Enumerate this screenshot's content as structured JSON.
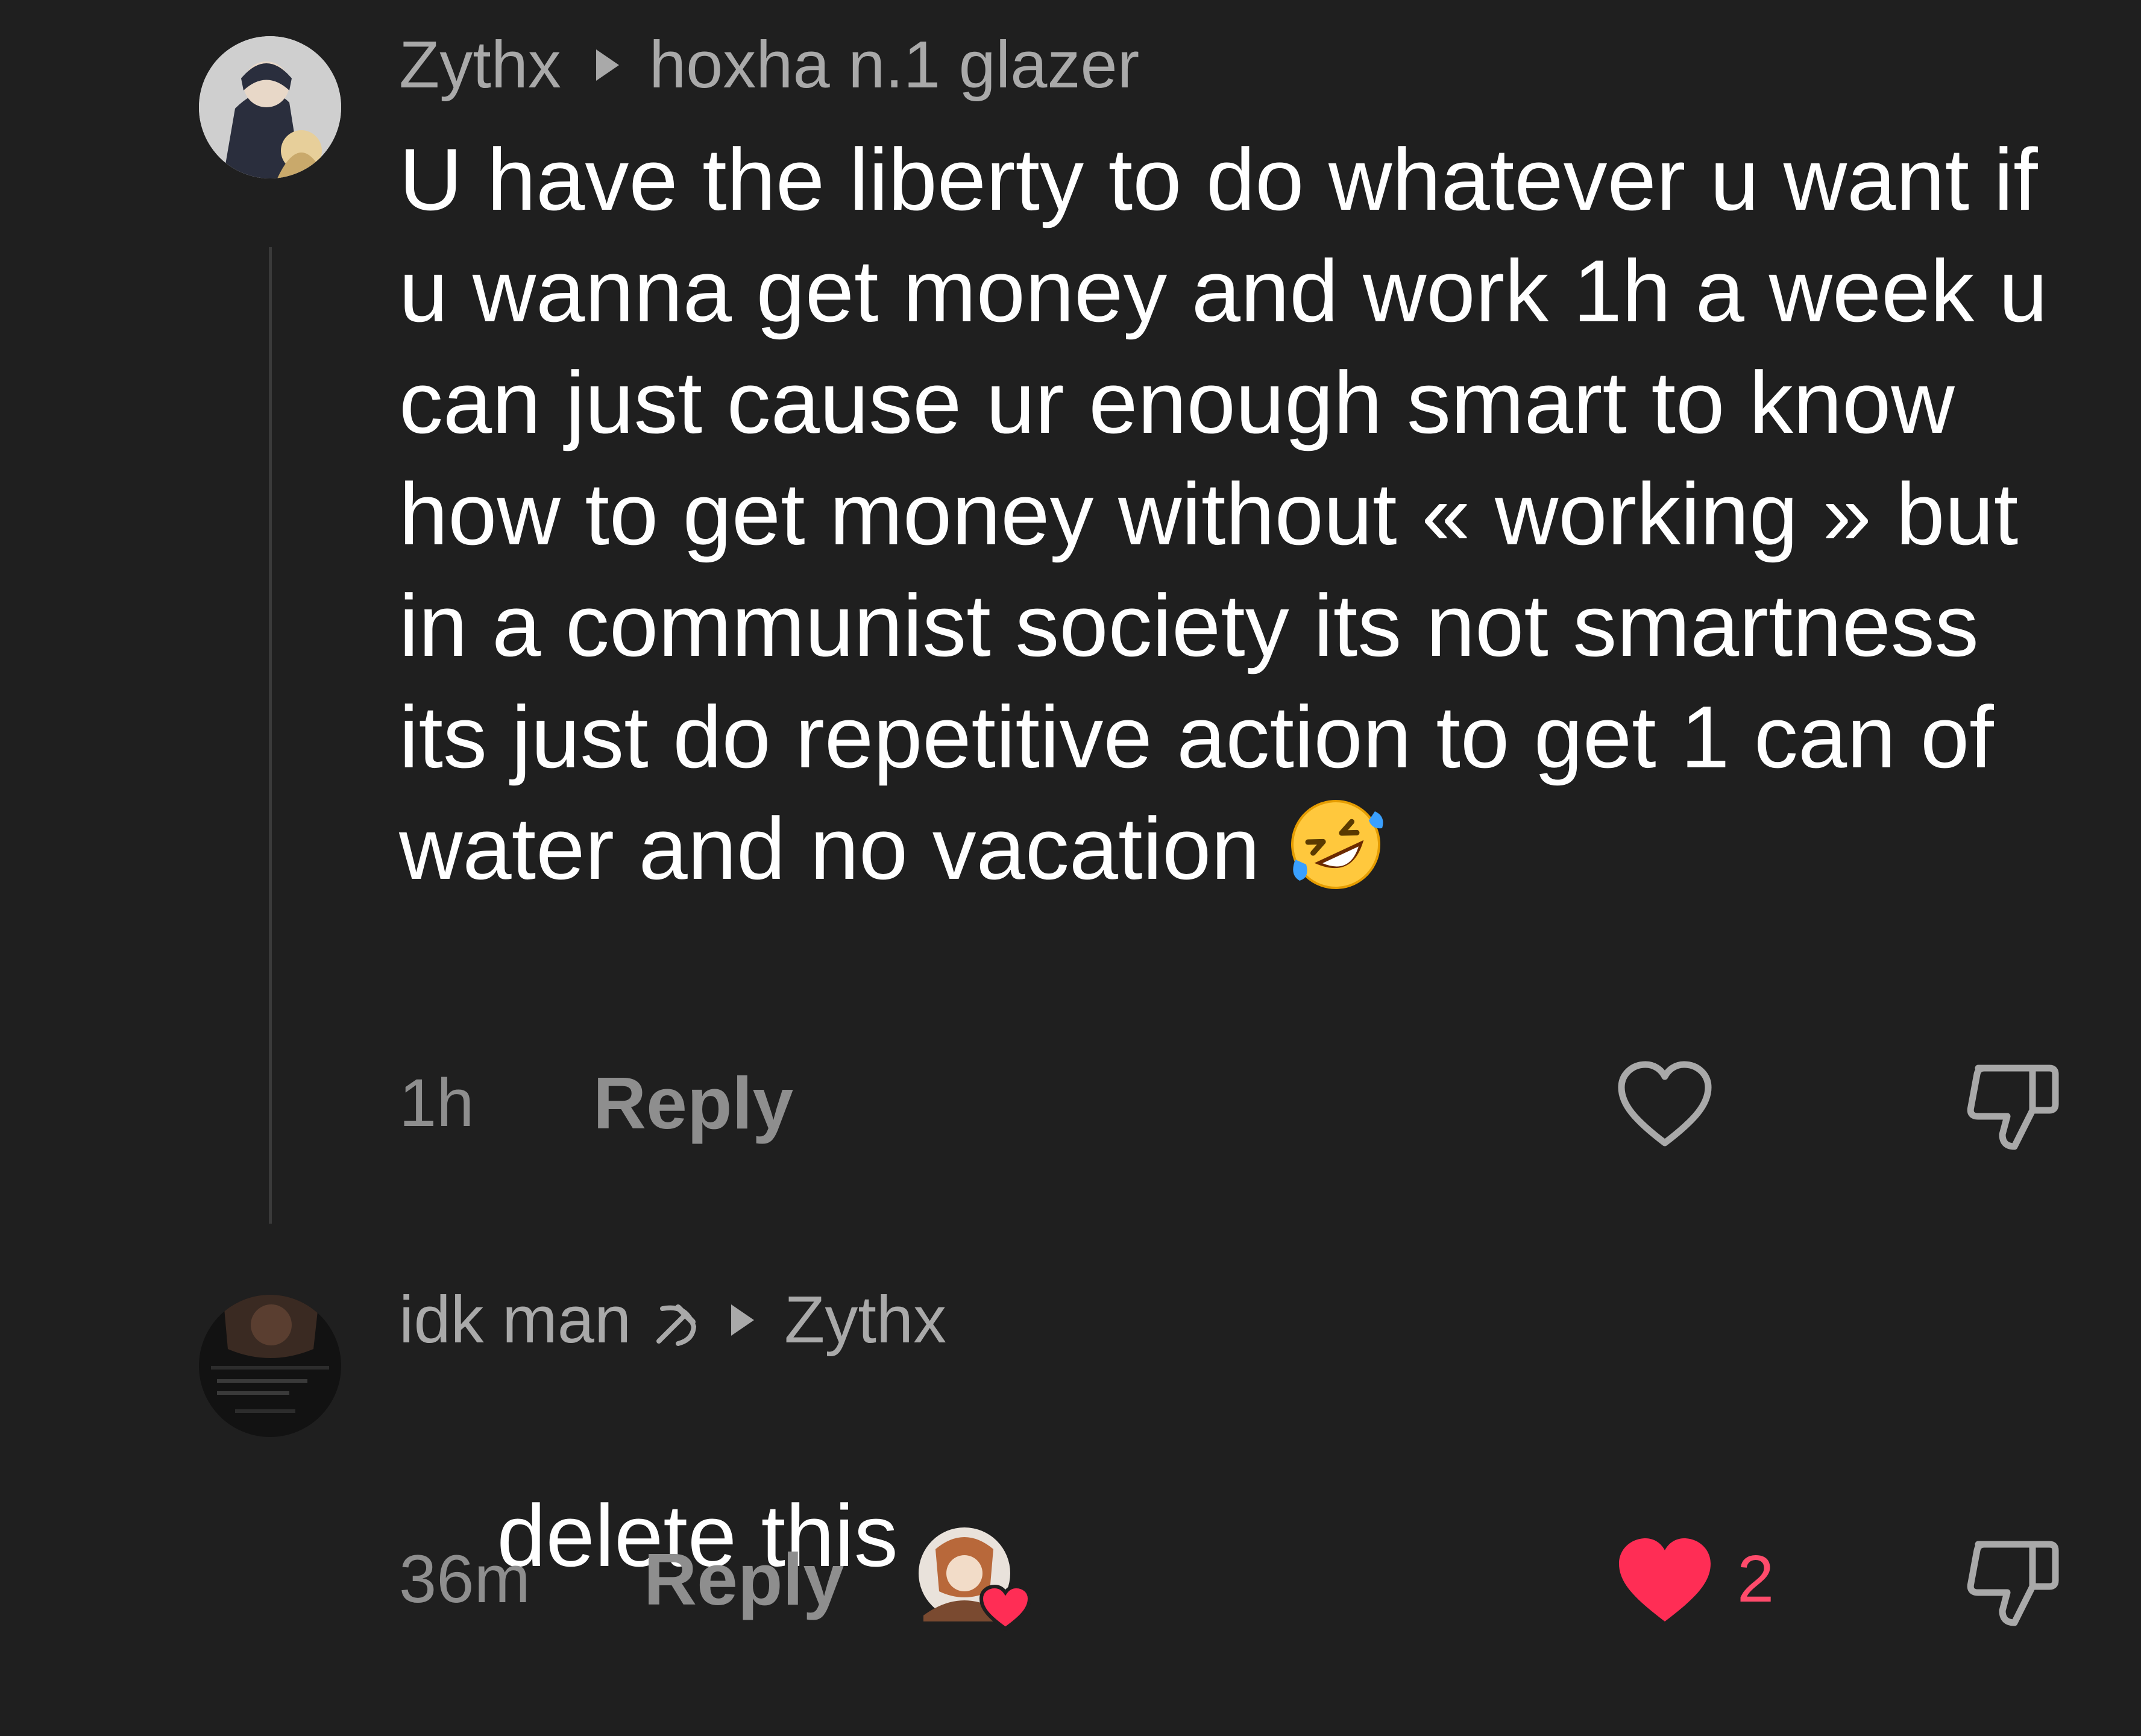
{
  "comments": [
    {
      "author": "Zythx",
      "reply_to": "hoxha n.1 glazer",
      "text": "U have the liberty to do whatever u want if u wanna get money and work 1h a week u can just cause ur enough smart to know how to get money without « working » but in a communist society its not smartness its just do repetitive action to get 1 can of water and no vacation ",
      "emoji": "rolling-on-floor-laughing-emoji",
      "time": "1h",
      "reply_label": "Reply",
      "liked": false,
      "like_count": ""
    },
    {
      "author": "idk man",
      "author_emblem": "hammer-and-sickle-icon",
      "reply_to": "Zythx",
      "text": "delete this",
      "time": "36m",
      "reply_label": "Reply",
      "liked": true,
      "like_count": "2",
      "liked_by_creator": true
    }
  ],
  "colors": {
    "background": "#1f1f1f",
    "text": "#ffffff",
    "muted": "#a9a9a9",
    "like": "#ff2d55"
  }
}
